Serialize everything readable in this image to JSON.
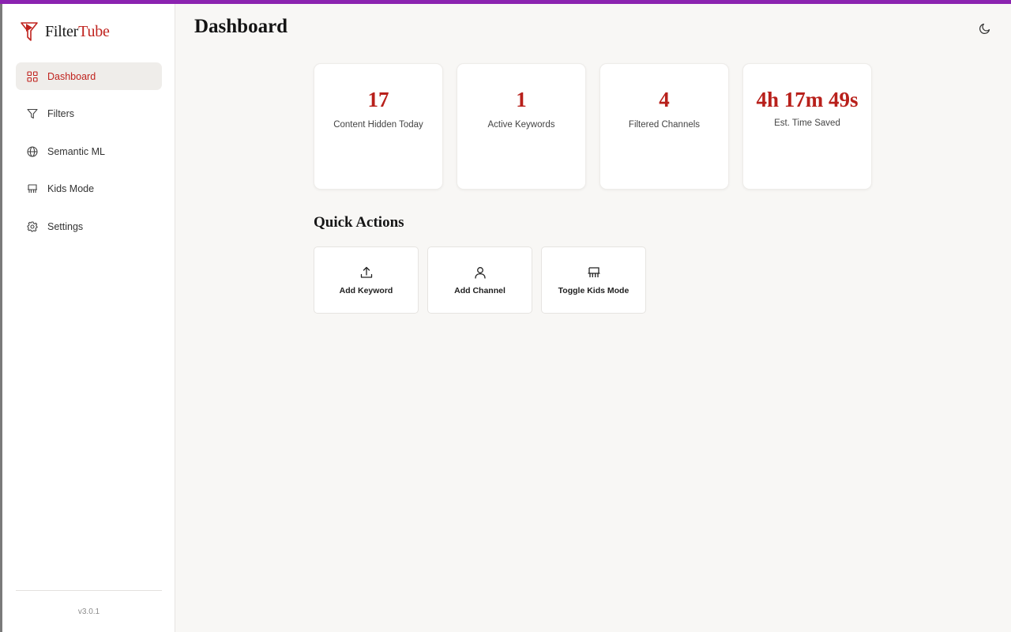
{
  "brand": {
    "name_part1": "Filter",
    "name_part2": "Tube",
    "accent_color": "#c0231e"
  },
  "sidebar": {
    "items": [
      {
        "label": "Dashboard",
        "icon": "grid-icon",
        "active": true
      },
      {
        "label": "Filters",
        "icon": "funnel-icon",
        "active": false
      },
      {
        "label": "Semantic ML",
        "icon": "globe-icon",
        "active": false
      },
      {
        "label": "Kids Mode",
        "icon": "stroller-icon",
        "active": false
      },
      {
        "label": "Settings",
        "icon": "gear-icon",
        "active": false
      }
    ],
    "version": "v3.0.1"
  },
  "header": {
    "title": "Dashboard",
    "theme_icon": "moon-icon"
  },
  "stats": [
    {
      "value": "17",
      "label": "Content Hidden Today"
    },
    {
      "value": "1",
      "label": "Active Keywords"
    },
    {
      "value": "4",
      "label": "Filtered Channels"
    },
    {
      "value": "4h 17m 49s",
      "label": "Est. Time Saved"
    }
  ],
  "quick_actions": {
    "title": "Quick Actions",
    "items": [
      {
        "label": "Add Keyword",
        "icon": "upload-icon"
      },
      {
        "label": "Add Channel",
        "icon": "user-icon"
      },
      {
        "label": "Toggle Kids Mode",
        "icon": "stroller-icon"
      }
    ]
  },
  "colors": {
    "top_bar": "#8b23b0",
    "stat_value": "#b8201b",
    "background": "#f8f7f5"
  }
}
